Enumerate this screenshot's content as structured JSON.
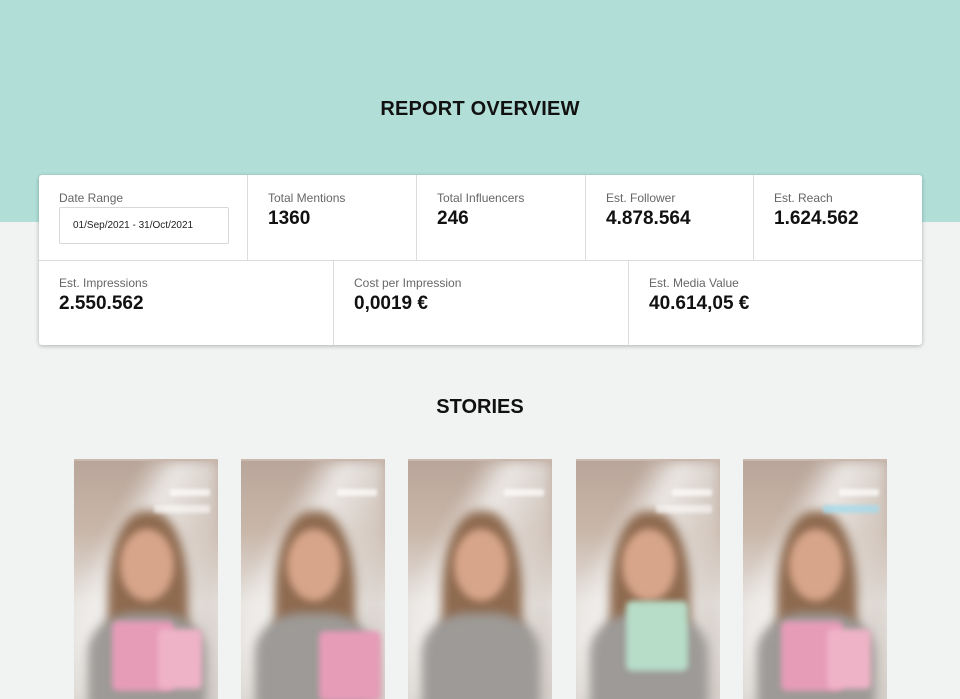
{
  "report": {
    "title": "REPORT OVERVIEW"
  },
  "stats": {
    "date_range": {
      "label": "Date Range",
      "value": "01/Sep/2021 - 31/Oct/2021"
    },
    "total_mentions": {
      "label": "Total Mentions",
      "value": "1360"
    },
    "total_influencers": {
      "label": "Total Influencers",
      "value": "246"
    },
    "est_follower": {
      "label": "Est. Follower",
      "value": "4.878.564"
    },
    "est_reach": {
      "label": "Est. Reach",
      "value": "1.624.562"
    },
    "est_impressions": {
      "label": "Est. Impressions",
      "value": "2.550.562"
    },
    "cost_per_impression": {
      "label": "Cost per Impression",
      "value": "0,0019 €"
    },
    "est_media_value": {
      "label": "Est. Media Value",
      "value": "40.614,05 €"
    }
  },
  "stories": {
    "title": "STORIES",
    "items": [
      {
        "variant": "pink-products"
      },
      {
        "variant": "pink-products"
      },
      {
        "variant": "no-product"
      },
      {
        "variant": "green-product"
      },
      {
        "variant": "pink-products"
      }
    ]
  },
  "colors": {
    "header_band": "#b1dfd8",
    "page_background": "#f1f3f2",
    "card_background": "#ffffff",
    "text_primary": "#111111",
    "text_label": "#666666"
  }
}
